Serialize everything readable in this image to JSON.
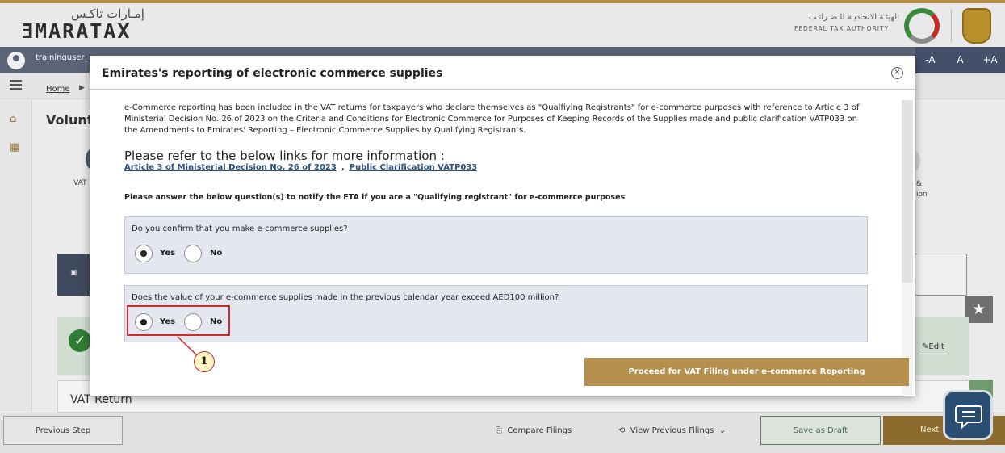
{
  "header": {
    "logo_arabic": "إمـارات تاكـس",
    "logo_english": "ƎMARATAX",
    "authority_arabic": "الهيئـة الاتحاديـة للـضـرائـب",
    "authority_english": "FEDERAL TAX AUTHORITY"
  },
  "userbar": {
    "username": "traininguser_",
    "font_controls": [
      "-A",
      "A",
      "+A"
    ]
  },
  "nav": {
    "home_label": "Home",
    "page_title": "Volunta",
    "step_left_label": "VAT",
    "step_right_label_1": "&",
    "step_right_label_2": "ion",
    "edit_label": "Edit",
    "vat_return_label": "VAT Return"
  },
  "bottom": {
    "previous_step": "Previous Step",
    "compare_filings": "Compare Filings",
    "view_previous_filings": "View Previous Filings",
    "save_as_draft": "Save as Draft",
    "next_label": "Next"
  },
  "modal": {
    "title": "Emirates's reporting of electronic commerce supplies",
    "intro": "e-Commerce reporting has been included in the VAT returns for taxpayers who declare themselves as \"Qualfiying Registrants\" for e-commerce purposes with reference to Article 3 of Ministerial Decision No. 26 of 2023 on the Criteria and Conditions for Electronic Commerce for Purposes of Keeping Records of the Supplies made and public clarification VATP033 on the Amendments to Emirates' Reporting – Electronic Commerce Supplies by Qualifying Registrants.",
    "refer_title": "Please refer to the below links for more information :",
    "link_1": "Article 3 of Ministerial Decision No. 26 of 2023",
    "link_separator": ",",
    "link_2": "Public Clarification VATP033",
    "instruction": "Please answer the below question(s) to notify the FTA if you are a \"Qualifying registrant\" for e-commerce purposes",
    "questions": [
      {
        "text": "Do you confirm that you make e-commerce supplies?",
        "yes_label": "Yes",
        "no_label": "No",
        "selected": "Yes"
      },
      {
        "text": "Does the value of your e-commerce supplies made in the previous calendar year exceed AED100 million?",
        "yes_label": "Yes",
        "no_label": "No",
        "selected": "Yes"
      }
    ],
    "proceed_button": "Proceed for VAT Filing under e-commerce Reporting",
    "callout_number": "1"
  },
  "colors": {
    "accent_gold": "#b58f4d",
    "userbar": "#5b6477",
    "highlight_red": "#d0282e",
    "question_bg": "#e5e7f0"
  }
}
